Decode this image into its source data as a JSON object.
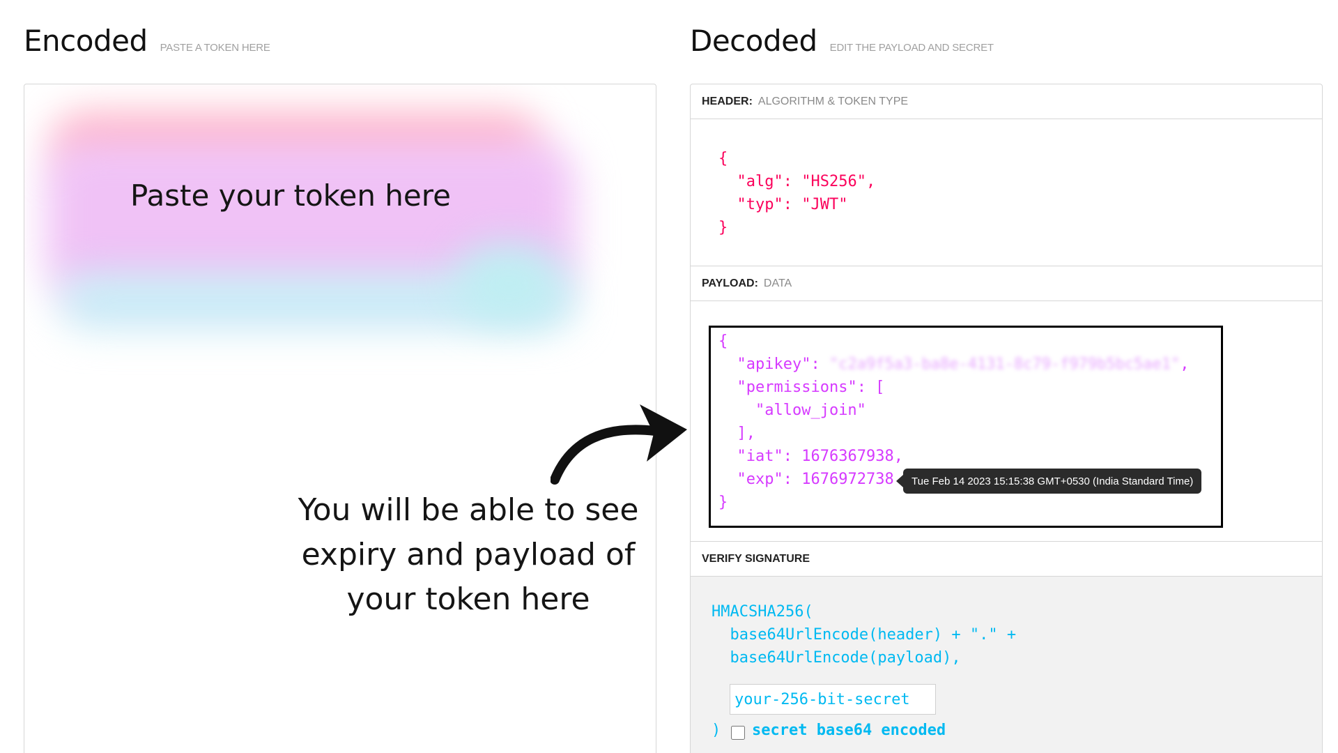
{
  "encoded": {
    "title": "Encoded",
    "subtitle": "PASTE A TOKEN HERE",
    "placeholder": "Paste your token here"
  },
  "decoded": {
    "title": "Decoded",
    "subtitle": "EDIT THE PAYLOAD AND SECRET"
  },
  "annotation": {
    "lines": [
      "You will be able to see",
      "expiry and payload of",
      "your token here"
    ]
  },
  "header_section": {
    "label": "HEADER:",
    "sub": "ALGORITHM & TOKEN TYPE",
    "alg_key": "\"alg\"",
    "alg_val": "\"HS256\"",
    "typ_key": "\"typ\"",
    "typ_val": "\"JWT\""
  },
  "payload_section": {
    "label": "PAYLOAD:",
    "sub": "DATA",
    "apikey_key": "\"apikey\"",
    "apikey_val": "\"c2a9f5a3-ba8e-4131-8c79-f979b5bc5ae1\"",
    "permissions_key": "\"permissions\"",
    "permission_item": "\"allow_join\"",
    "iat_key": "\"iat\"",
    "iat_val": "1676367938",
    "exp_key": "\"exp\"",
    "exp_val": "1676972738",
    "exp_tooltip": "Tue Feb 14 2023 15:15:38 GMT+0530 (India Standard Time)"
  },
  "verify_section": {
    "label": "VERIFY SIGNATURE",
    "fn": "HMACSHA256(",
    "line1": "  base64UrlEncode(header) + \".\" +",
    "line2": "  base64UrlEncode(payload),",
    "secret_placeholder": "your-256-bit-secret",
    "close": ")",
    "checkbox_label": "secret base64 encoded"
  },
  "colors": {
    "header_red": "#fb015b",
    "payload_purple": "#d63aff",
    "signature_cyan": "#00b9f1"
  }
}
